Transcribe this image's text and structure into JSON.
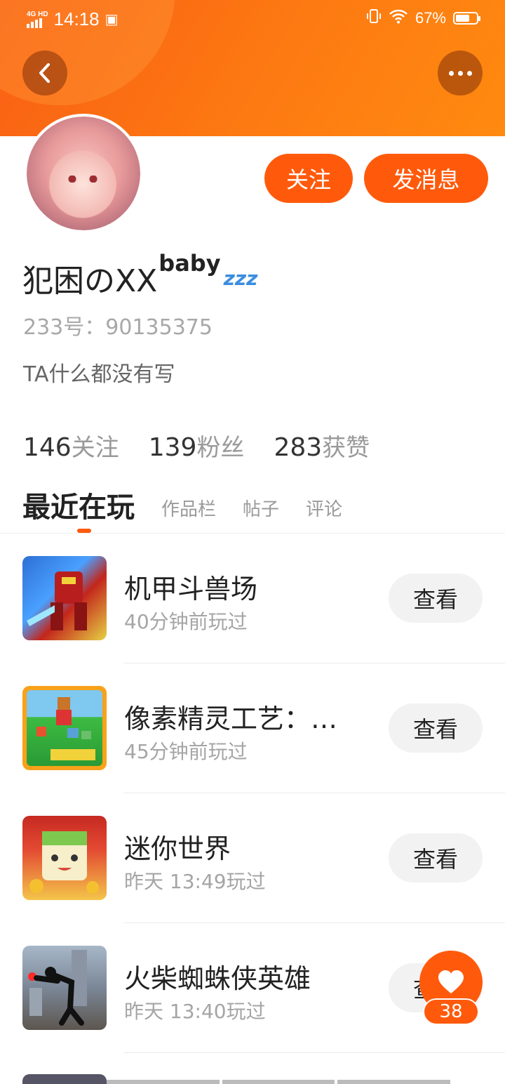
{
  "status_bar": {
    "network": "4G HD",
    "time": "14:18",
    "battery": "67%",
    "battery_level": 0.67
  },
  "profile": {
    "name": "犯困のXX",
    "name_sup": "baby",
    "name_emoji": "zzz",
    "id_line": "233号：90135375",
    "bio": "TA什么都没有写",
    "follow_label": "关注",
    "message_label": "发消息"
  },
  "stats": [
    {
      "value": "146",
      "label": "关注"
    },
    {
      "value": "139",
      "label": "粉丝"
    },
    {
      "value": "283",
      "label": "获赞"
    }
  ],
  "tabs": [
    {
      "label": "最近在玩",
      "active": true
    },
    {
      "label": "作品栏",
      "active": false
    },
    {
      "label": "帖子",
      "active": false
    },
    {
      "label": "评论",
      "active": false
    }
  ],
  "games": [
    {
      "name": "机甲斗兽场",
      "time": "40分钟前玩过",
      "button": "查看",
      "icon": "mecha-game-icon"
    },
    {
      "name": "像素精灵工艺：…",
      "time": "45分钟前玩过",
      "button": "查看",
      "icon": "pixelmon-game-icon"
    },
    {
      "name": "迷你世界",
      "time": "昨天 13:49玩过",
      "button": "查看",
      "icon": "mini-world-game-icon"
    },
    {
      "name": "火柴蜘蛛侠英雄",
      "time": "昨天 13:40玩过",
      "button": "查看",
      "icon": "stickman-game-icon"
    }
  ],
  "like": {
    "count": "38",
    "icon": "heart-icon"
  },
  "colors": {
    "accent": "#ff5a0c",
    "header_gradient_start": "#f95f14",
    "header_gradient_end": "#ff8a10",
    "button_grey": "#f2f2f2"
  }
}
